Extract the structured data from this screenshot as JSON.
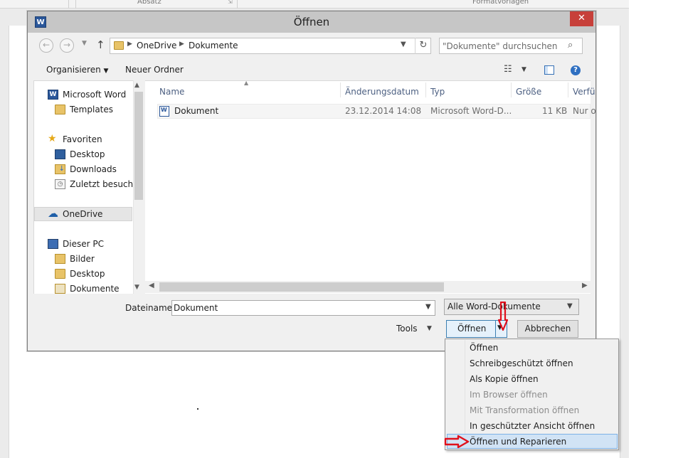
{
  "background": {
    "ribbon_labels": [
      "Absatz",
      "Formatvorlagen"
    ]
  },
  "dialog": {
    "title": "Öffnen",
    "app_icon_letter": "W",
    "close_glyph": "✕",
    "address": {
      "crumbs": [
        "OneDrive",
        "Dokumente"
      ]
    },
    "search": {
      "placeholder": "\"Dokumente\" durchsuchen"
    },
    "toolbar": {
      "organize": "Organisieren",
      "new_folder": "Neuer Ordner",
      "help_glyph": "?"
    },
    "nav": {
      "items": [
        {
          "label": "Microsoft Word",
          "icon": "word-icon"
        },
        {
          "label": "Templates",
          "icon": "folder-icon"
        },
        {
          "label": "Favoriten",
          "icon": "star-icon"
        },
        {
          "label": "Desktop",
          "icon": "desktop-icon"
        },
        {
          "label": "Downloads",
          "icon": "downloads-icon"
        },
        {
          "label": "Zuletzt besucht",
          "icon": "recent-places-icon"
        },
        {
          "label": "OneDrive",
          "icon": "onedrive-icon"
        },
        {
          "label": "Dieser PC",
          "icon": "computer-icon"
        },
        {
          "label": "Bilder",
          "icon": "pictures-folder-icon"
        },
        {
          "label": "Desktop",
          "icon": "desktop-folder-icon"
        },
        {
          "label": "Dokumente",
          "icon": "documents-folder-icon"
        }
      ]
    },
    "columns": [
      "Name",
      "Änderungsdatum",
      "Typ",
      "Größe",
      "Verfü"
    ],
    "files": [
      {
        "name": "Dokument",
        "modified": "23.12.2014 14:08",
        "type": "Microsoft Word-D...",
        "size": "11 KB",
        "availability": "Nur o"
      }
    ],
    "filename_label": "Dateiname:",
    "filename_value": "Dokument",
    "filter_value": "Alle Word-Dokumente",
    "tools_label": "Tools",
    "open_label": "Öffnen",
    "cancel_label": "Abbrechen",
    "open_menu": [
      {
        "label": "Öffnen",
        "enabled": true
      },
      {
        "label": "Schreibgeschützt öffnen",
        "enabled": true
      },
      {
        "label": "Als Kopie öffnen",
        "enabled": true
      },
      {
        "label": "Im Browser öffnen",
        "enabled": false
      },
      {
        "label": "Mit Transformation öffnen",
        "enabled": false
      },
      {
        "label": "In geschützter Ansicht öffnen",
        "enabled": true
      },
      {
        "label": "Öffnen und Reparieren",
        "enabled": true,
        "highlighted": true
      }
    ]
  },
  "colors": {
    "title_bar": "#c6c6c6",
    "close_button": "#c7403a",
    "annotation_arrow": "#e0101c",
    "menu_highlight": "#d1e3f5"
  }
}
